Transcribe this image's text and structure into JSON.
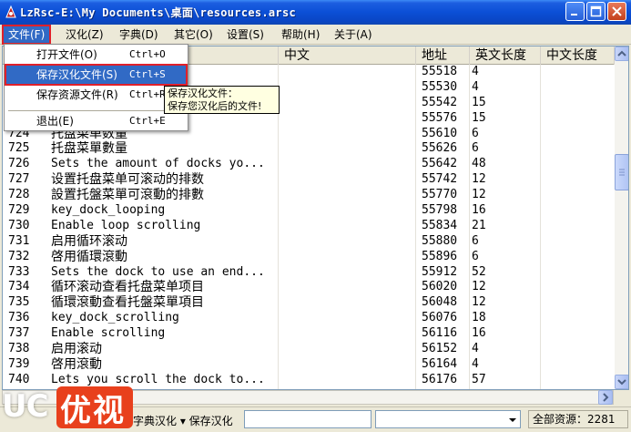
{
  "window": {
    "title": "LzRsc-E:\\My Documents\\桌面\\resources.arsc",
    "colors": {
      "titlebar": "#0b4fd6",
      "highlight": "#316ac5",
      "annotation": "#e0202a"
    }
  },
  "menubar": {
    "items": [
      "文件(F)",
      "汉化(Z)",
      "字典(D)",
      "其它(O)",
      "设置(S)",
      "帮助(H)",
      "关于(A)"
    ]
  },
  "columns": {
    "text": "中文",
    "addr": "地址",
    "en_len": "英文长度",
    "cn_len": "中文长度"
  },
  "file_menu": {
    "items": [
      {
        "label": "打开文件(O)",
        "shortcut": "Ctrl+O"
      },
      {
        "label": "保存汉化文件(S)",
        "shortcut": "Ctrl+S"
      },
      {
        "label": "保存资源文件(R)",
        "shortcut": "Ctrl+R"
      },
      {
        "label": "退出(E)",
        "shortcut": "Ctrl+E"
      }
    ]
  },
  "tooltip": {
    "line1": "保存汉化文件：",
    "line2": "保存您汉化后的文件!"
  },
  "rows": [
    {
      "idx": "",
      "text": "",
      "addr": "55518",
      "en": "4"
    },
    {
      "idx": "",
      "text": "",
      "addr": "55530",
      "en": "4"
    },
    {
      "idx": "",
      "text": "",
      "addr": "55542",
      "en": "15"
    },
    {
      "idx": "",
      "text": "",
      "addr": "55576",
      "en": "15"
    },
    {
      "idx": "724",
      "text": "托盘菜单数量",
      "addr": "55610",
      "en": "6"
    },
    {
      "idx": "725",
      "text": "托盘菜單數量",
      "addr": "55626",
      "en": "6"
    },
    {
      "idx": "726",
      "text": "Sets the amount of docks yo...",
      "addr": "55642",
      "en": "48"
    },
    {
      "idx": "727",
      "text": "设置托盘菜单可滚动的排数",
      "addr": "55742",
      "en": "12"
    },
    {
      "idx": "728",
      "text": "設置托盤菜單可滾動的排數",
      "addr": "55770",
      "en": "12"
    },
    {
      "idx": "729",
      "text": "key_dock_looping",
      "addr": "55798",
      "en": "16"
    },
    {
      "idx": "730",
      "text": "Enable loop scrolling",
      "addr": "55834",
      "en": "21"
    },
    {
      "idx": "731",
      "text": "启用循环滚动",
      "addr": "55880",
      "en": "6"
    },
    {
      "idx": "732",
      "text": "啓用循環滾動",
      "addr": "55896",
      "en": "6"
    },
    {
      "idx": "733",
      "text": "Sets the dock to use an end...",
      "addr": "55912",
      "en": "52"
    },
    {
      "idx": "734",
      "text": "循环滚动查看托盘菜单项目",
      "addr": "56020",
      "en": "12"
    },
    {
      "idx": "735",
      "text": "循環滾動查看托盤菜單項目",
      "addr": "56048",
      "en": "12"
    },
    {
      "idx": "736",
      "text": "key_dock_scrolling",
      "addr": "56076",
      "en": "18"
    },
    {
      "idx": "737",
      "text": "Enable scrolling",
      "addr": "56116",
      "en": "16"
    },
    {
      "idx": "738",
      "text": "启用滚动",
      "addr": "56152",
      "en": "4"
    },
    {
      "idx": "739",
      "text": "啓用滾動",
      "addr": "56164",
      "en": "4"
    },
    {
      "idx": "740",
      "text": "Lets you scroll the dock to...",
      "addr": "56176",
      "en": "57"
    }
  ],
  "statusbar": {
    "left_text": "字典汉化 ▾ 保存汉化",
    "total": "全部资源：2281"
  },
  "logo": {
    "uc": "UC",
    "badge": "优视"
  }
}
